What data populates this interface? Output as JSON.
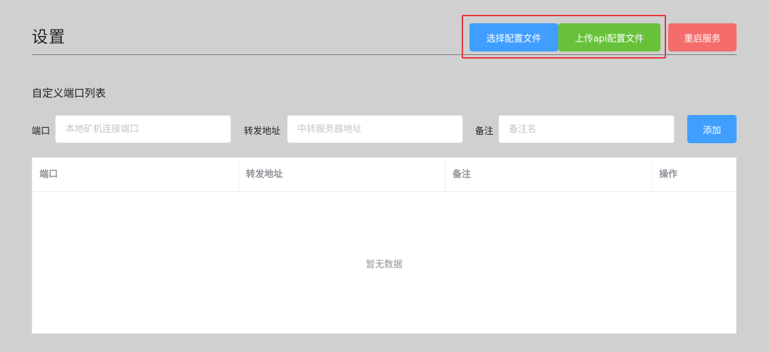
{
  "header": {
    "title": "设置",
    "select_config_label": "选择配置文件",
    "upload_api_config_label": "上传api配置文件",
    "restart_label": "重启服务"
  },
  "section": {
    "title": "自定义端口列表"
  },
  "form": {
    "port_label": "端口",
    "port_placeholder": "本地矿机连接端口",
    "forward_label": "转发地址",
    "forward_placeholder": "中转服务器地址",
    "remark_label": "备注",
    "remark_placeholder": "备注名",
    "add_label": "添加"
  },
  "table": {
    "columns": [
      "端口",
      "转发地址",
      "备注",
      "操作"
    ],
    "rows": [],
    "empty_text": "暂无数据"
  },
  "colors": {
    "primary": "#409eff",
    "success": "#67c23a",
    "danger": "#f56c6c",
    "highlight": "#e8353c"
  }
}
